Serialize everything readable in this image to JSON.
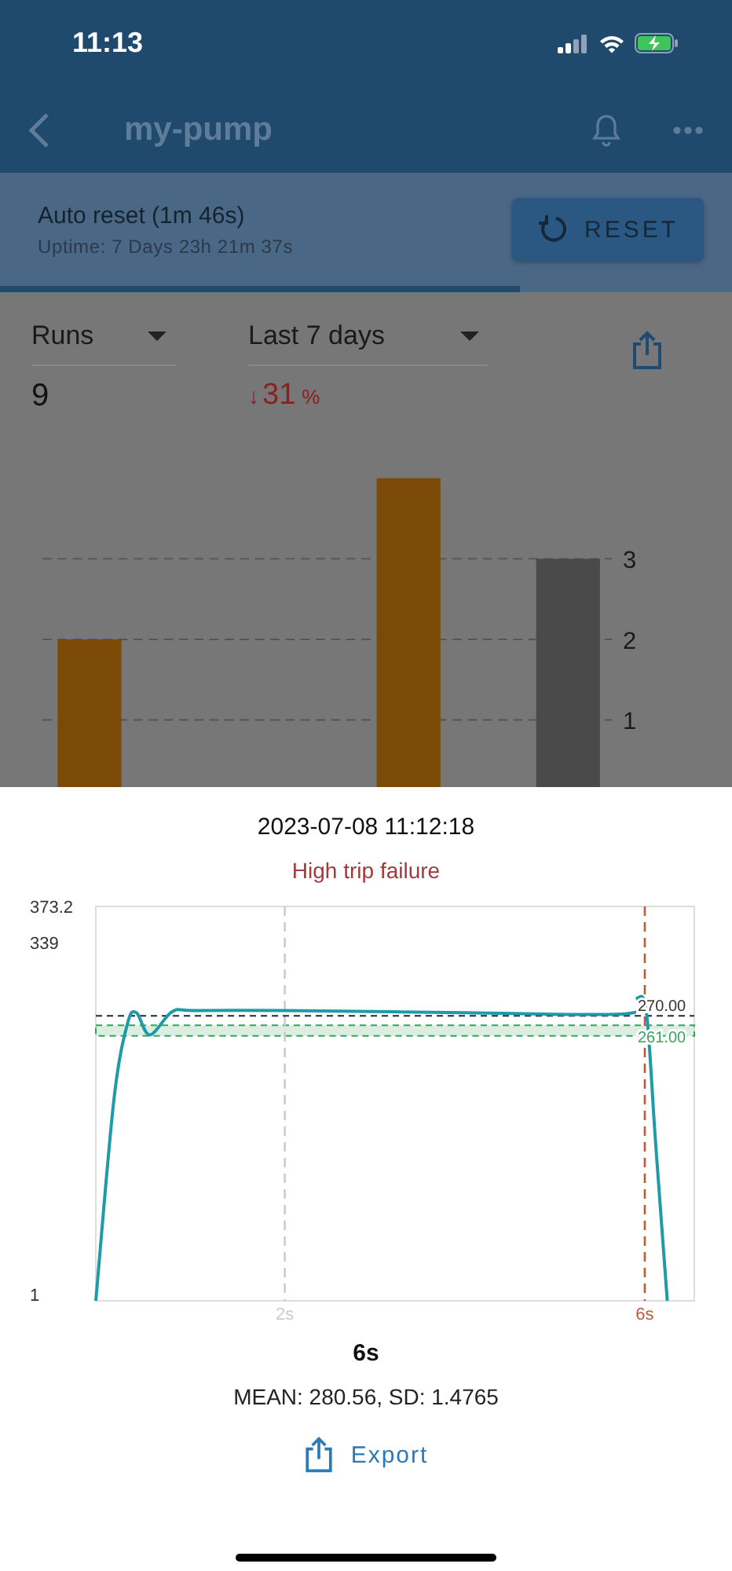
{
  "status_bar": {
    "time": "11:13"
  },
  "nav": {
    "title": "my-pump"
  },
  "reset_banner": {
    "title": "Auto reset (1m 46s)",
    "subtitle": "Uptime: 7 Days 23h 21m 37s",
    "button": "RESET",
    "level": 0.71
  },
  "stats": {
    "metric": "Runs",
    "period": "Last 7 days",
    "value": "9",
    "change": {
      "arrow": "↓",
      "value": "31",
      "unit": "%"
    },
    "chart_data": {
      "type": "bar",
      "ylim": [
        0,
        4
      ],
      "yticks": [
        1,
        2,
        3
      ],
      "grid": true,
      "stacked": true,
      "series": [
        {
          "color": "#7a4a06",
          "values": [
            2,
            0,
            4,
            null
          ]
        },
        {
          "color": "#4a4a4a",
          "values": [
            null,
            null,
            null,
            3
          ]
        }
      ]
    }
  },
  "sheet": {
    "timestamp": "2023-07-08 11:12:18",
    "event": "High trip failure",
    "chart_data": {
      "type": "line",
      "ylim": [
        1,
        373.2
      ],
      "xlim": [
        -0.1,
        6.55
      ],
      "yticks": [
        1,
        339,
        373.2
      ],
      "xticks": [
        {
          "value": 2,
          "label": "2s"
        },
        {
          "value": 6,
          "label": "6s"
        }
      ],
      "x": [
        -0.1,
        0.1,
        0.25,
        0.35,
        0.5,
        0.75,
        1,
        2,
        4,
        5.8,
        5.92,
        6.02,
        6.12,
        6.25
      ],
      "series": [
        {
          "color": "#1f9aa8",
          "values": [
            1,
            190,
            262,
            273,
            252,
            274,
            275,
            275,
            273,
            272,
            287,
            272,
            150,
            1
          ]
        }
      ],
      "ref_lines": [
        {
          "axis": "x",
          "value": 2,
          "color": "#cccccc"
        },
        {
          "axis": "x",
          "value": 6,
          "color": "#c0583a"
        },
        {
          "axis": "y",
          "value": 270,
          "color": "#1a2a3a",
          "label": "270.00"
        }
      ],
      "bands": [
        {
          "axis": "y",
          "from": 251,
          "to": 261,
          "color": "#3aa35a",
          "label": "261.00"
        }
      ]
    },
    "duration": "6s",
    "summary": "MEAN: 280.56, SD: 1.4765",
    "export": "Export"
  }
}
